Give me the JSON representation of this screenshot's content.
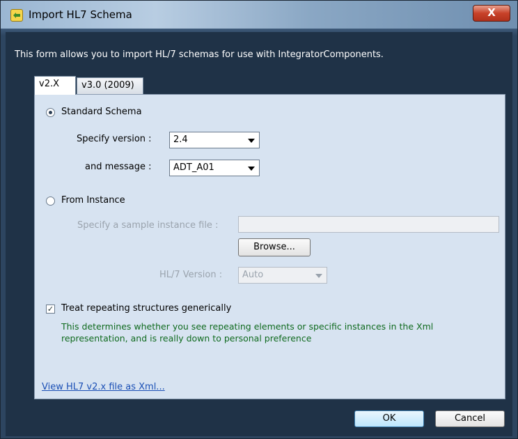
{
  "window": {
    "title": "Import HL7 Schema",
    "close_label": "X"
  },
  "description": "This form allows you to import HL/7 schemas for use with IntegratorComponents.",
  "tabs": [
    {
      "label": "v2.X",
      "active": true
    },
    {
      "label": "v3.0 (2009)",
      "active": false
    }
  ],
  "standard_schema": {
    "label": "Standard Schema",
    "selected": true,
    "version_label": "Specify version :",
    "version_value": "2.4",
    "message_label": "and message :",
    "message_value": "ADT_A01"
  },
  "from_instance": {
    "label": "From Instance",
    "selected": false,
    "file_label": "Specify a sample instance file :",
    "file_value": "",
    "browse_label": "Browse...",
    "hl7_version_label": "HL/7 Version :",
    "hl7_version_value": "Auto"
  },
  "repeating": {
    "label": "Treat repeating structures generically",
    "checked": true,
    "check_glyph": "✓",
    "note": "This determines whether you see repeating elements or specific instances in the Xml representation, and is really down to personal preference"
  },
  "link": "View HL7 v2.x file as Xml...",
  "buttons": {
    "ok": "OK",
    "cancel": "Cancel"
  }
}
